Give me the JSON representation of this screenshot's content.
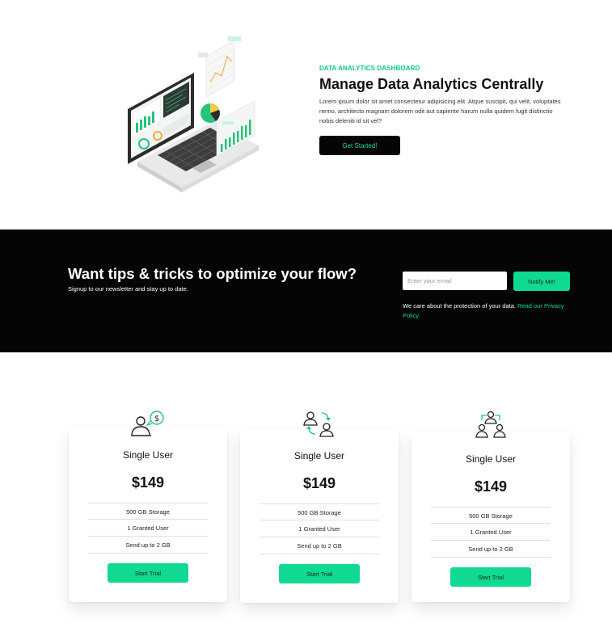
{
  "hero": {
    "eyebrow": "DATA ANALYTICS DASHBOARD",
    "title": "Manage Data Analytics Centrally",
    "description": "Lorem ipsum dolor sit amet consectetur adipisicing elit. Atque suscipit, qui velit, voluptates nemo, architecto magnam dolorem odit aut sapiente harum nulla quidem fugit distinctio nobis deleniti id sit vel?",
    "cta_label": "Get Started!",
    "illustration_icon": "analytics-laptop-illustration"
  },
  "newsletter": {
    "title": "Want tips & tricks to optimize your flow?",
    "subtitle": "Signup to our newsletter and stay up to date.",
    "email_placeholder": "Enter your email",
    "notify_label": "Notify Me!",
    "privacy_text": "We care about the protection of your data.",
    "privacy_link": "Read our Privacy Policy."
  },
  "pricing": {
    "cards": [
      {
        "icon": "user-dollar-icon",
        "title": "Single User",
        "price": "$149",
        "features": [
          "500 GB Storage",
          "1 Granted User",
          "Send up to 2 GB"
        ],
        "button": "Start Trial"
      },
      {
        "icon": "users-exchange-icon",
        "title": "Single User",
        "price": "$149",
        "features": [
          "500 GB Storage",
          "1 Granted User",
          "Send up to 2 GB"
        ],
        "button": "Start Trial"
      },
      {
        "icon": "team-group-icon",
        "title": "Single User",
        "price": "$149",
        "features": [
          "500 GB Storage",
          "1 Granted User",
          "Send up to 2 GB"
        ],
        "button": "Start Trial"
      }
    ]
  },
  "colors": {
    "accent": "#10d992",
    "accent_text": "#10c985",
    "dark": "#050505"
  }
}
